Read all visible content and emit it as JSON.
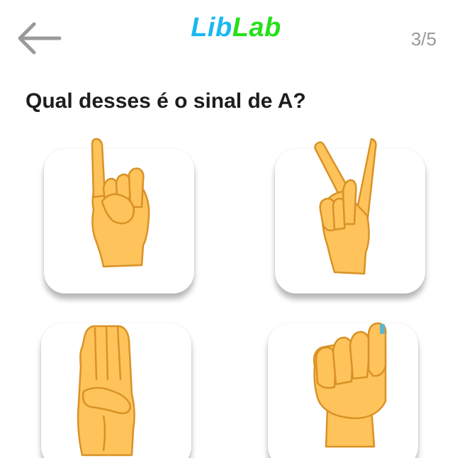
{
  "header": {
    "back_icon": "arrow-left-icon",
    "logo_part1": "Lib",
    "logo_part2": "Lab",
    "progress": "3/5"
  },
  "question": "Qual desses é o sinal de A?",
  "options": [
    {
      "icon": "hand-sign-pinky-up-icon"
    },
    {
      "icon": "hand-sign-crossed-fingers-icon"
    },
    {
      "icon": "hand-sign-flat-palm-icon"
    },
    {
      "icon": "hand-sign-fist-thumb-side-icon"
    }
  ],
  "colors": {
    "logo_lib": "#1ab8f0",
    "logo_lab": "#26e01a",
    "skin_fill": "#ffc35c",
    "skin_outline": "#d99225",
    "nail": "#5bb7c9"
  }
}
